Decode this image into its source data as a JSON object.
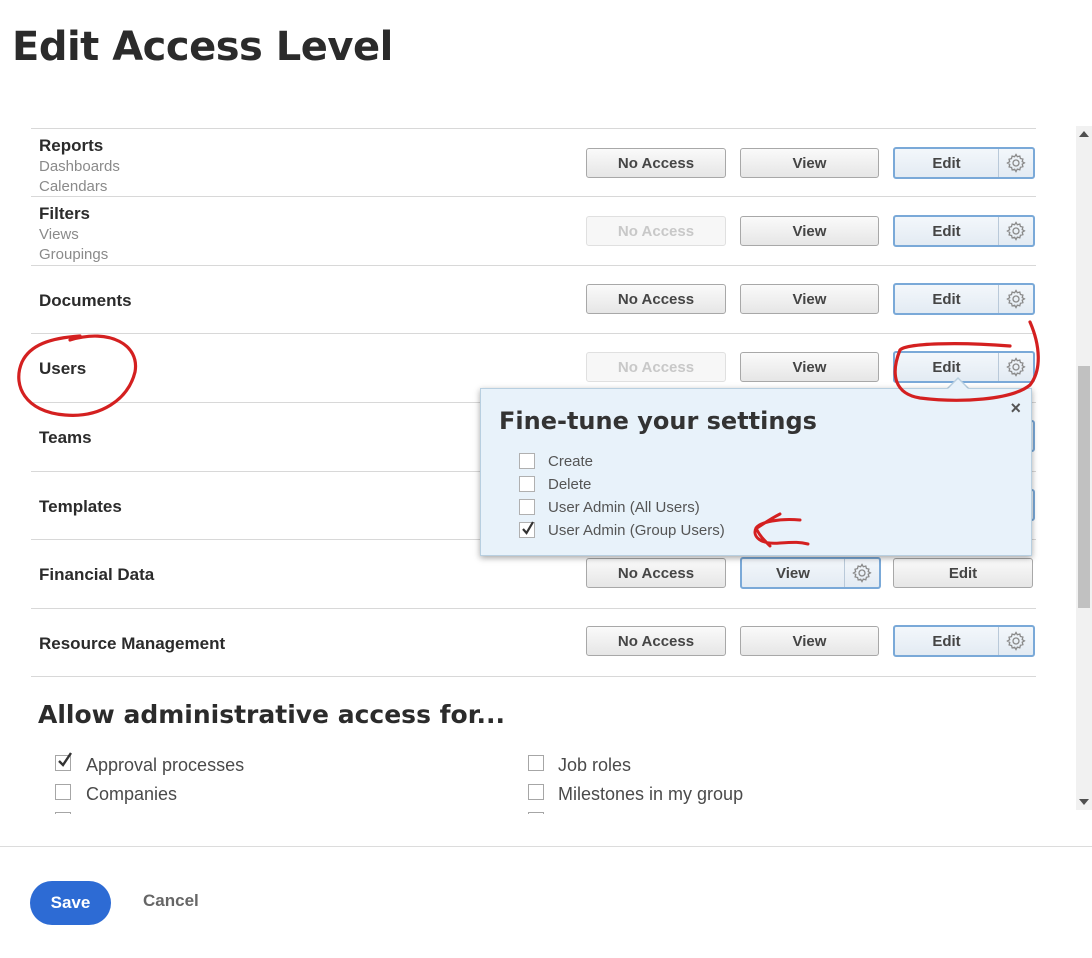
{
  "title": "Edit Access Level",
  "buttons": {
    "no_access": "No Access",
    "view": "View",
    "edit": "Edit"
  },
  "rows": [
    {
      "name": "Reports",
      "subs": [
        "Dashboards",
        "Calendars"
      ],
      "no_access_disabled": false,
      "selected": "Edit"
    },
    {
      "name": "Filters",
      "subs": [
        "Views",
        "Groupings"
      ],
      "no_access_disabled": true,
      "selected": "Edit"
    },
    {
      "name": "Documents",
      "subs": [],
      "no_access_disabled": false,
      "selected": "Edit"
    },
    {
      "name": "Users",
      "subs": [],
      "no_access_disabled": true,
      "selected": "Edit"
    },
    {
      "name": "Teams",
      "subs": [],
      "selected": "Edit"
    },
    {
      "name": "Templates",
      "subs": [],
      "selected": "Edit"
    },
    {
      "name": "Financial Data",
      "subs": [],
      "no_access_disabled": false,
      "selected": "View"
    },
    {
      "name": "Resource Management",
      "subs": [],
      "no_access_disabled": false,
      "selected": "Edit"
    }
  ],
  "popup": {
    "title": "Fine-tune your settings",
    "close": "×",
    "options": [
      {
        "label": "Create",
        "checked": false
      },
      {
        "label": "Delete",
        "checked": false
      },
      {
        "label": "User Admin (All Users)",
        "checked": false
      },
      {
        "label": "User Admin (Group Users)",
        "checked": true
      }
    ]
  },
  "admin_section": {
    "title": "Allow administrative access for...",
    "items": [
      {
        "label": "Approval processes",
        "checked": true
      },
      {
        "label": "Companies",
        "checked": false
      },
      {
        "label": "Job roles",
        "checked": false
      },
      {
        "label": "Milestones in my group",
        "checked": false
      }
    ]
  },
  "footer": {
    "save": "Save",
    "cancel": "Cancel"
  },
  "colors": {
    "primary": "#2d6bd4",
    "selected_border": "#7aa9d8",
    "annotation": "#d42020"
  },
  "icons": {
    "gear": "gear-icon",
    "check": "checkmark-icon",
    "close": "close-icon"
  }
}
